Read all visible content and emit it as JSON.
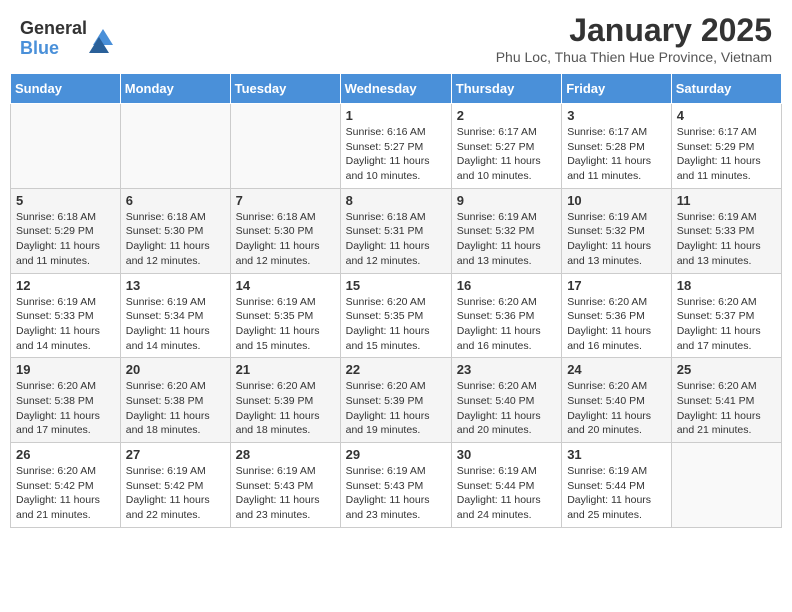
{
  "header": {
    "logo_general": "General",
    "logo_blue": "Blue",
    "month_title": "January 2025",
    "subtitle": "Phu Loc, Thua Thien Hue Province, Vietnam"
  },
  "days_of_week": [
    "Sunday",
    "Monday",
    "Tuesday",
    "Wednesday",
    "Thursday",
    "Friday",
    "Saturday"
  ],
  "weeks": [
    [
      {
        "day": "",
        "info": ""
      },
      {
        "day": "",
        "info": ""
      },
      {
        "day": "",
        "info": ""
      },
      {
        "day": "1",
        "info": "Sunrise: 6:16 AM\nSunset: 5:27 PM\nDaylight: 11 hours\nand 10 minutes."
      },
      {
        "day": "2",
        "info": "Sunrise: 6:17 AM\nSunset: 5:27 PM\nDaylight: 11 hours\nand 10 minutes."
      },
      {
        "day": "3",
        "info": "Sunrise: 6:17 AM\nSunset: 5:28 PM\nDaylight: 11 hours\nand 11 minutes."
      },
      {
        "day": "4",
        "info": "Sunrise: 6:17 AM\nSunset: 5:29 PM\nDaylight: 11 hours\nand 11 minutes."
      }
    ],
    [
      {
        "day": "5",
        "info": "Sunrise: 6:18 AM\nSunset: 5:29 PM\nDaylight: 11 hours\nand 11 minutes."
      },
      {
        "day": "6",
        "info": "Sunrise: 6:18 AM\nSunset: 5:30 PM\nDaylight: 11 hours\nand 12 minutes."
      },
      {
        "day": "7",
        "info": "Sunrise: 6:18 AM\nSunset: 5:30 PM\nDaylight: 11 hours\nand 12 minutes."
      },
      {
        "day": "8",
        "info": "Sunrise: 6:18 AM\nSunset: 5:31 PM\nDaylight: 11 hours\nand 12 minutes."
      },
      {
        "day": "9",
        "info": "Sunrise: 6:19 AM\nSunset: 5:32 PM\nDaylight: 11 hours\nand 13 minutes."
      },
      {
        "day": "10",
        "info": "Sunrise: 6:19 AM\nSunset: 5:32 PM\nDaylight: 11 hours\nand 13 minutes."
      },
      {
        "day": "11",
        "info": "Sunrise: 6:19 AM\nSunset: 5:33 PM\nDaylight: 11 hours\nand 13 minutes."
      }
    ],
    [
      {
        "day": "12",
        "info": "Sunrise: 6:19 AM\nSunset: 5:33 PM\nDaylight: 11 hours\nand 14 minutes."
      },
      {
        "day": "13",
        "info": "Sunrise: 6:19 AM\nSunset: 5:34 PM\nDaylight: 11 hours\nand 14 minutes."
      },
      {
        "day": "14",
        "info": "Sunrise: 6:19 AM\nSunset: 5:35 PM\nDaylight: 11 hours\nand 15 minutes."
      },
      {
        "day": "15",
        "info": "Sunrise: 6:20 AM\nSunset: 5:35 PM\nDaylight: 11 hours\nand 15 minutes."
      },
      {
        "day": "16",
        "info": "Sunrise: 6:20 AM\nSunset: 5:36 PM\nDaylight: 11 hours\nand 16 minutes."
      },
      {
        "day": "17",
        "info": "Sunrise: 6:20 AM\nSunset: 5:36 PM\nDaylight: 11 hours\nand 16 minutes."
      },
      {
        "day": "18",
        "info": "Sunrise: 6:20 AM\nSunset: 5:37 PM\nDaylight: 11 hours\nand 17 minutes."
      }
    ],
    [
      {
        "day": "19",
        "info": "Sunrise: 6:20 AM\nSunset: 5:38 PM\nDaylight: 11 hours\nand 17 minutes."
      },
      {
        "day": "20",
        "info": "Sunrise: 6:20 AM\nSunset: 5:38 PM\nDaylight: 11 hours\nand 18 minutes."
      },
      {
        "day": "21",
        "info": "Sunrise: 6:20 AM\nSunset: 5:39 PM\nDaylight: 11 hours\nand 18 minutes."
      },
      {
        "day": "22",
        "info": "Sunrise: 6:20 AM\nSunset: 5:39 PM\nDaylight: 11 hours\nand 19 minutes."
      },
      {
        "day": "23",
        "info": "Sunrise: 6:20 AM\nSunset: 5:40 PM\nDaylight: 11 hours\nand 20 minutes."
      },
      {
        "day": "24",
        "info": "Sunrise: 6:20 AM\nSunset: 5:40 PM\nDaylight: 11 hours\nand 20 minutes."
      },
      {
        "day": "25",
        "info": "Sunrise: 6:20 AM\nSunset: 5:41 PM\nDaylight: 11 hours\nand 21 minutes."
      }
    ],
    [
      {
        "day": "26",
        "info": "Sunrise: 6:20 AM\nSunset: 5:42 PM\nDaylight: 11 hours\nand 21 minutes."
      },
      {
        "day": "27",
        "info": "Sunrise: 6:19 AM\nSunset: 5:42 PM\nDaylight: 11 hours\nand 22 minutes."
      },
      {
        "day": "28",
        "info": "Sunrise: 6:19 AM\nSunset: 5:43 PM\nDaylight: 11 hours\nand 23 minutes."
      },
      {
        "day": "29",
        "info": "Sunrise: 6:19 AM\nSunset: 5:43 PM\nDaylight: 11 hours\nand 23 minutes."
      },
      {
        "day": "30",
        "info": "Sunrise: 6:19 AM\nSunset: 5:44 PM\nDaylight: 11 hours\nand 24 minutes."
      },
      {
        "day": "31",
        "info": "Sunrise: 6:19 AM\nSunset: 5:44 PM\nDaylight: 11 hours\nand 25 minutes."
      },
      {
        "day": "",
        "info": ""
      }
    ]
  ]
}
